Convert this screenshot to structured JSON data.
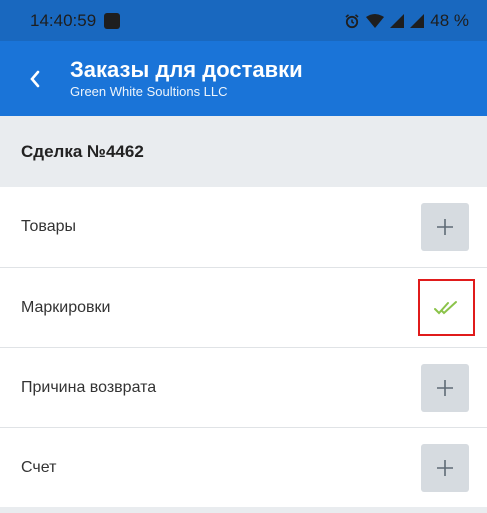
{
  "status_bar": {
    "time": "14:40:59",
    "battery": "48 %",
    "icons": [
      "alarm-icon",
      "wifi-icon",
      "signal-icon",
      "signal-icon"
    ]
  },
  "app_bar": {
    "title": "Заказы для доставки",
    "subtitle": "Green White Soultions LLC",
    "back_icon": "chevron-left-icon"
  },
  "deal": {
    "title": "Сделка №4462"
  },
  "items": [
    {
      "label": "Товары",
      "action": "add",
      "icon": "plus-icon"
    },
    {
      "label": "Маркировки",
      "action": "done",
      "icon": "double-check-icon"
    },
    {
      "label": "Причина возврата",
      "action": "add",
      "icon": "plus-icon"
    },
    {
      "label": "Счет",
      "action": "add",
      "icon": "plus-icon"
    }
  ],
  "colors": {
    "status_bar": "#1968bf",
    "app_bar": "#1a74d8",
    "check": "#8bc34a",
    "highlight_border": "#e01b1b"
  }
}
